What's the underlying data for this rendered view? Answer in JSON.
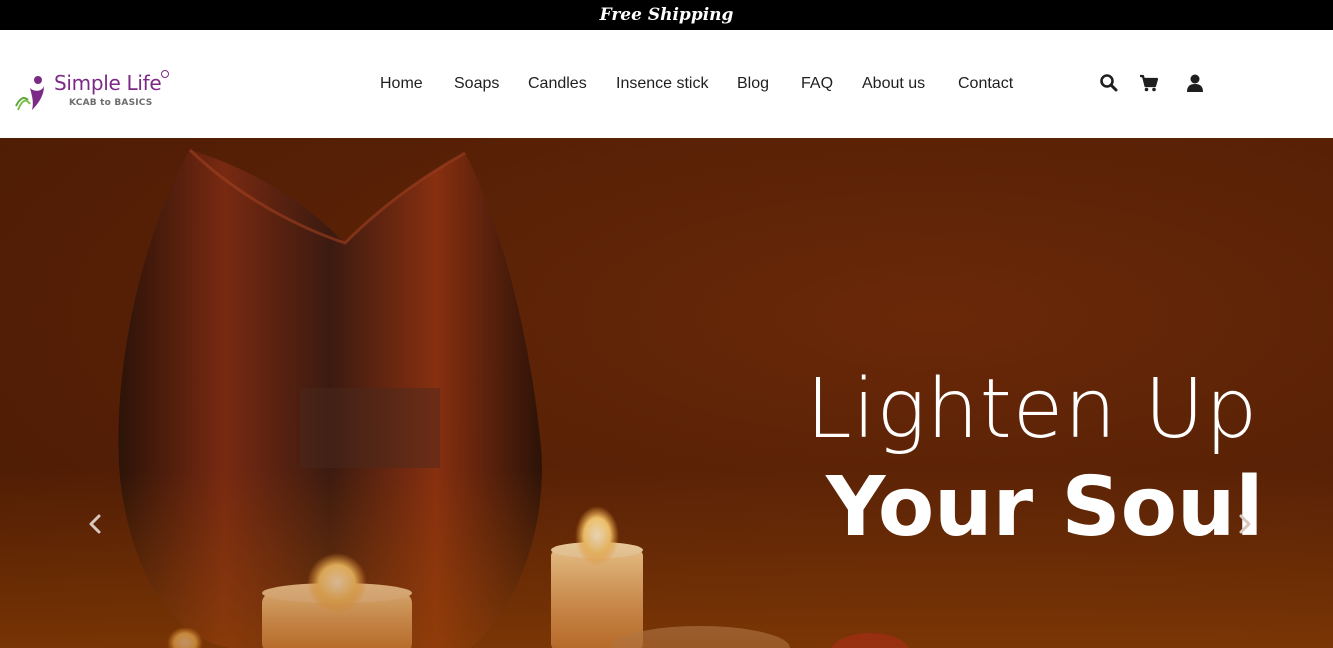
{
  "topbar": {
    "text": "Free Shipping"
  },
  "logo": {
    "name": "Simple Life",
    "tagline": "KCAB to BASICS"
  },
  "nav": {
    "items": [
      "Home",
      "Soaps",
      "Candles",
      "Insence stick",
      "Blog",
      "FAQ",
      "About us",
      "Contact"
    ]
  },
  "icons": {
    "search": "search-icon",
    "cart": "cart-icon",
    "account": "user-icon"
  },
  "hero": {
    "line1": "Lighten Up",
    "line2": "Your Soul",
    "prev": "chevron-left-icon",
    "next": "chevron-right-icon"
  },
  "colors": {
    "topbar": "#000000",
    "brand": "#7b2a86",
    "hero_bg": "#5a2206"
  }
}
